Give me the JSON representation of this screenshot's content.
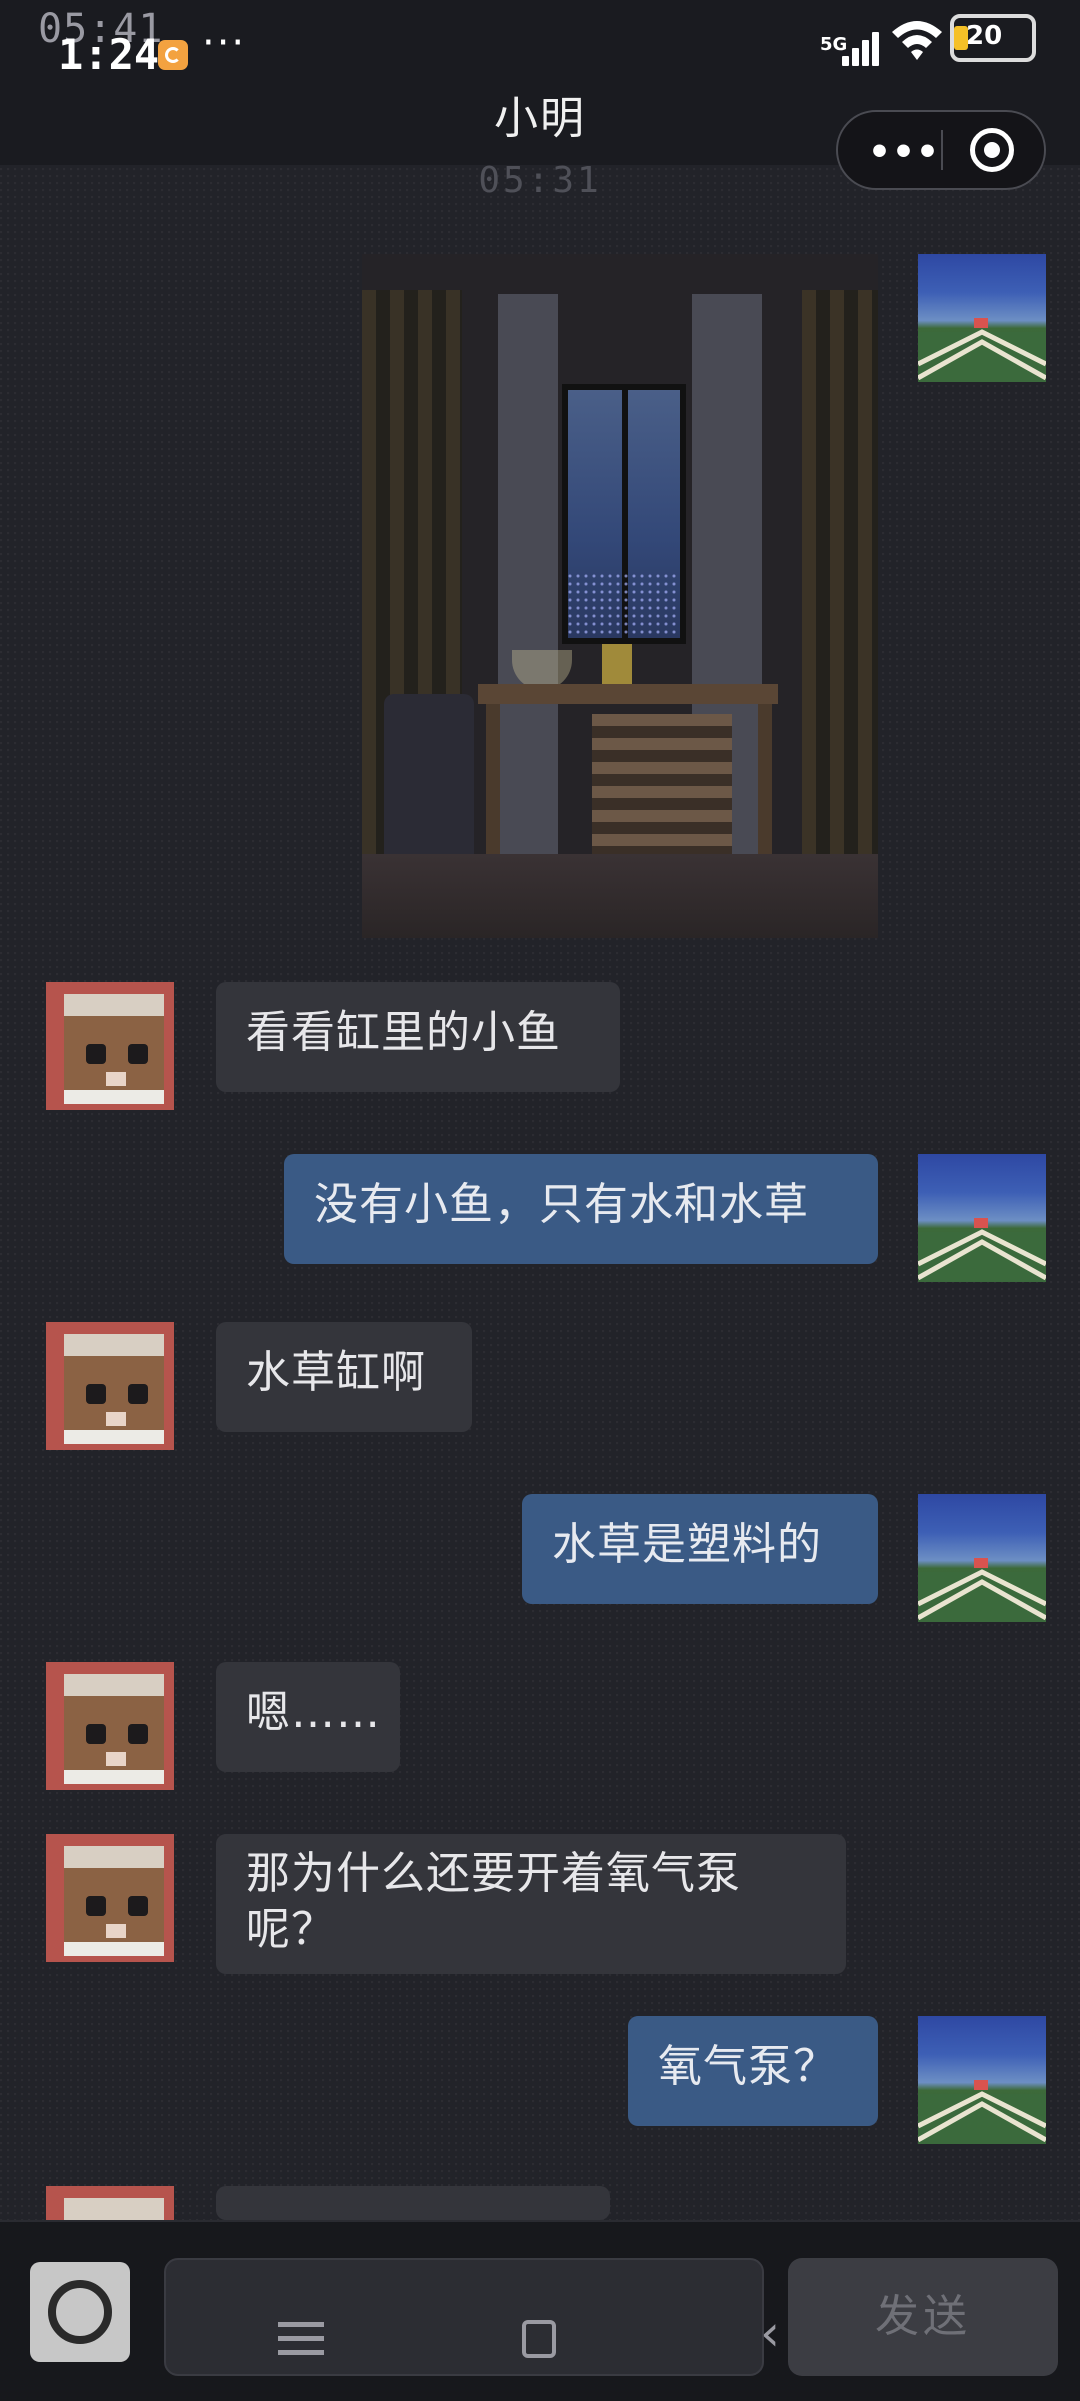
{
  "status_bar": {
    "time_ghost": "05:41",
    "time": "1:24",
    "dots": "···",
    "network": "5G",
    "battery": "20"
  },
  "header": {
    "title": "小明",
    "timestamp": "05:31"
  },
  "messages": [
    {
      "from": "me",
      "type": "image"
    },
    {
      "from": "other",
      "text": "看看缸里的小鱼"
    },
    {
      "from": "me",
      "text": "没有小鱼，只有水和水草"
    },
    {
      "from": "other",
      "text": "水草缸啊"
    },
    {
      "from": "me",
      "text": "水草是塑料的"
    },
    {
      "from": "other",
      "text": "嗯……"
    },
    {
      "from": "other",
      "line1": "那为什么还要开着氧气泵",
      "line2": "呢？"
    },
    {
      "from": "me",
      "text": "氧气泵？"
    }
  ],
  "input": {
    "send_label": "发送"
  }
}
